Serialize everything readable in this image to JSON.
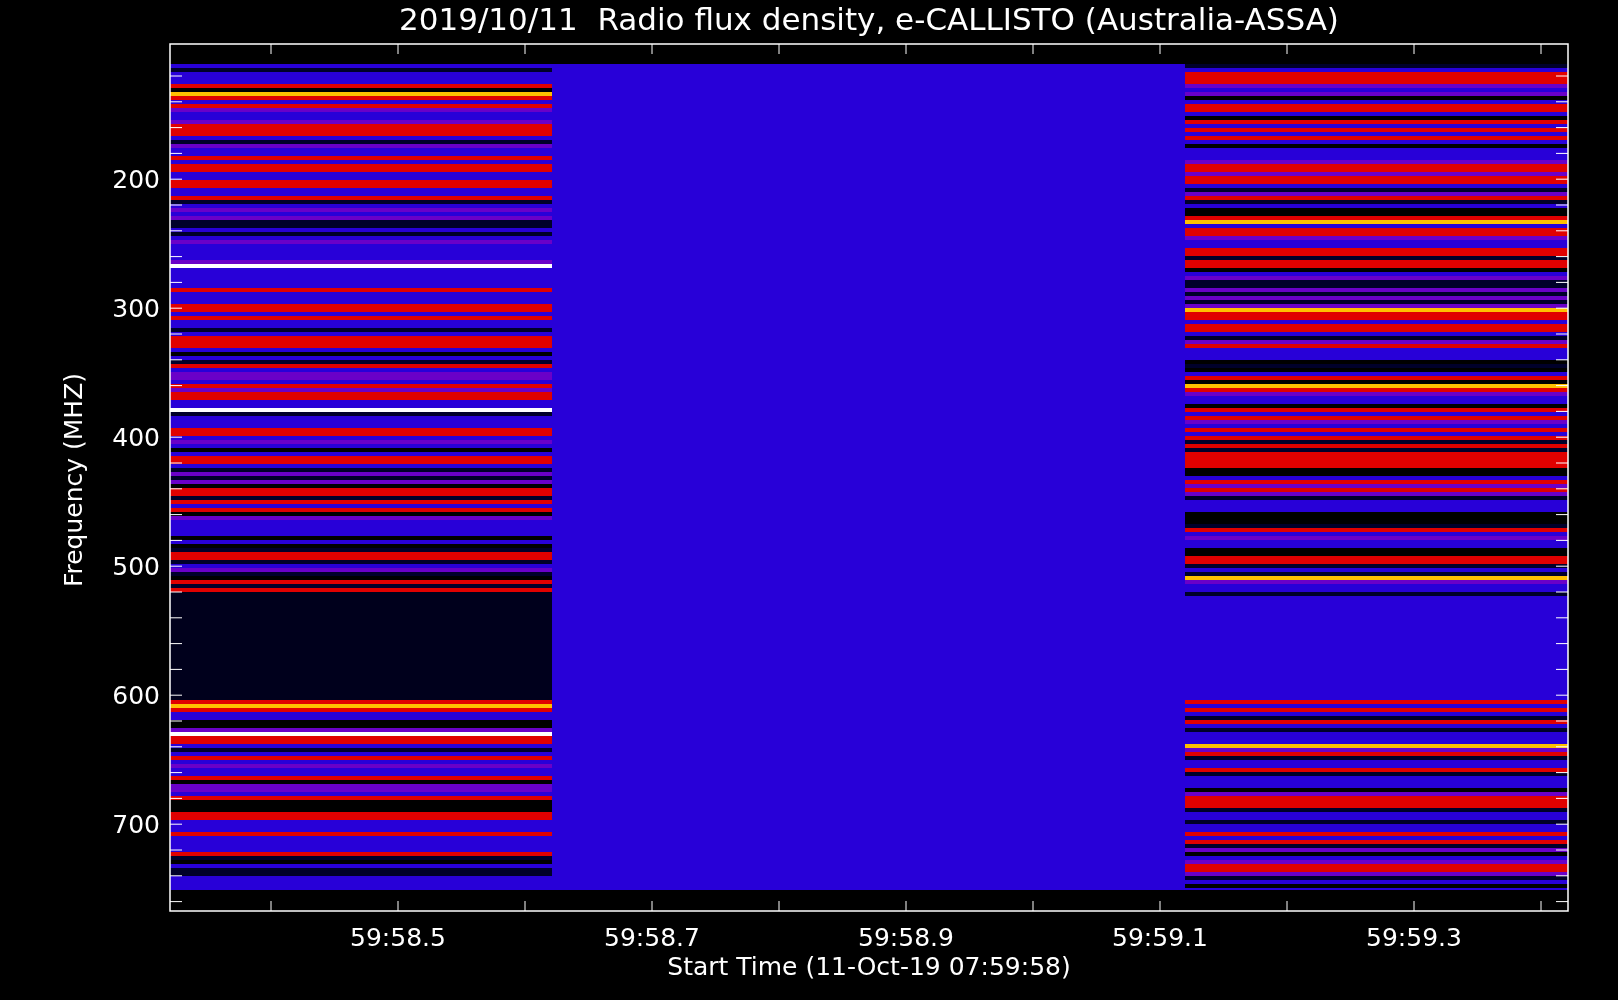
{
  "title": "2019/10/11  Radio flux density, e-CALLISTO (Australia-ASSA)",
  "y_axis": {
    "label": "Frequency (MHZ)",
    "ticks": [
      "200",
      "300",
      "400",
      "500",
      "600",
      "700"
    ]
  },
  "x_axis": {
    "label": "Start Time (11-Oct-19 07:59:58)",
    "ticks": [
      "59:58.5",
      "59:58.7",
      "59:58.9",
      "59:59.1",
      "59:59.3"
    ]
  }
}
